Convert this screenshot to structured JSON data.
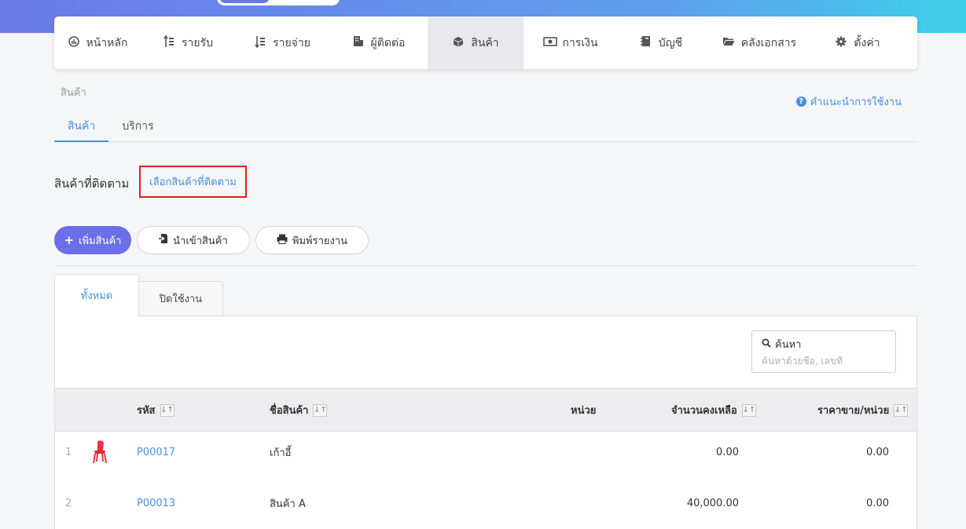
{
  "nav": {
    "items": [
      {
        "label": "หน้าหลัก",
        "icon": "dashboard-icon"
      },
      {
        "label": "รายรับ",
        "icon": "income-icon"
      },
      {
        "label": "รายจ่าย",
        "icon": "expense-icon"
      },
      {
        "label": "ผู้ติดต่อ",
        "icon": "contacts-icon"
      },
      {
        "label": "สินค้า",
        "icon": "box-icon",
        "active": true
      },
      {
        "label": "การเงิน",
        "icon": "money-icon"
      },
      {
        "label": "บัญชี",
        "icon": "ledger-icon"
      },
      {
        "label": "คลังเอกสาร",
        "icon": "folder-icon"
      },
      {
        "label": "ตั้งค่า",
        "icon": "gear-icon"
      }
    ]
  },
  "breadcrumb": "สินค้า",
  "help_link": "คำแนะนำการใช้งาน",
  "subtabs": [
    {
      "label": "สินค้า",
      "active": true
    },
    {
      "label": "บริการ"
    }
  ],
  "tracked": {
    "label": "สินค้าที่ติดตาม",
    "link": "เลือกสินค้าที่ติดตาม"
  },
  "actions": {
    "add": "เพิ่มสินค้า",
    "import": "นำเข้าสินค้า",
    "print": "พิมพ์รายงาน"
  },
  "status_tabs": {
    "all": "ทั้งหมด",
    "disabled": "ปิดใช้งาน"
  },
  "search": {
    "label": "ค้นหา",
    "placeholder": "ค้นหาด้วยชื่อ, เลขที่"
  },
  "table": {
    "headers": {
      "code": "รหัส",
      "name": "ชื่อสินค้า",
      "unit": "หน่วย",
      "stock": "จำนวนคงเหลือ",
      "price": "ราคาขาย/หน่วย"
    },
    "rows": [
      {
        "num": "1",
        "code": "P00017",
        "name": "เก้าอี้",
        "unit": "",
        "stock": "0.00",
        "price": "0.00",
        "has_image": true
      },
      {
        "num": "2",
        "code": "P00013",
        "name": "สินค้า A",
        "unit": "",
        "stock": "40,000.00",
        "price": "0.00",
        "has_image": false
      }
    ]
  },
  "colors": {
    "accent": "#4a90d9",
    "primary_button": "#6b6fe8",
    "highlight_border": "#e02020"
  }
}
